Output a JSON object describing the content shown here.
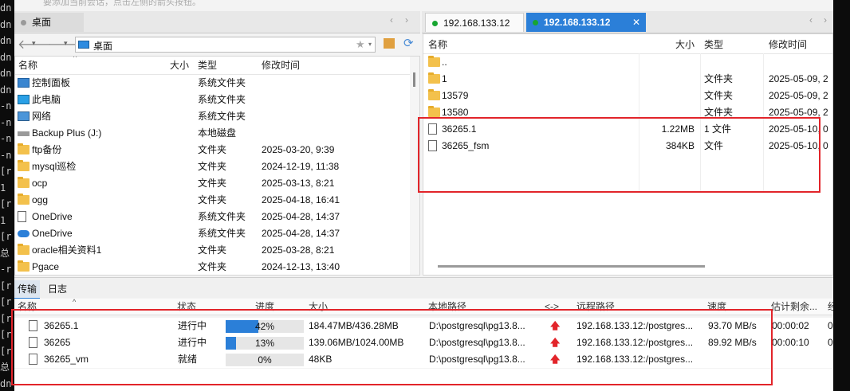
{
  "top_hint": "要添加当前会话，点击左侧的箭头按钮。",
  "terminal_lines": [
    "dn",
    "dn",
    "dn",
    "dn",
    "dn",
    "dn",
    "-n",
    "-n",
    "-n",
    "-n",
    "[r",
    "1",
    "[r",
    "1",
    "[r",
    "总",
    "-r",
    "[r",
    "[r",
    "[r",
    "[r",
    "[r",
    "总",
    "dn",
    "dn"
  ],
  "left_tab": {
    "label": "桌面"
  },
  "right_tabs": [
    {
      "label": "192.168.133.12",
      "active": false
    },
    {
      "label": "192.168.133.12",
      "active": true
    }
  ],
  "address": {
    "path": "桌面"
  },
  "left_pane": {
    "columns": [
      "名称",
      "大小",
      "类型",
      "修改时间"
    ],
    "rows": [
      {
        "name": "控制面板",
        "size": "",
        "type": "系统文件夹",
        "mtime": "",
        "icon": "control-panel-icon"
      },
      {
        "name": "此电脑",
        "size": "",
        "type": "系统文件夹",
        "mtime": "",
        "icon": "computer-icon"
      },
      {
        "name": "网络",
        "size": "",
        "type": "系统文件夹",
        "mtime": "",
        "icon": "network-icon"
      },
      {
        "name": "Backup Plus (J:)",
        "size": "",
        "type": "本地磁盘",
        "mtime": "",
        "icon": "drive-icon"
      },
      {
        "name": "ftp备份",
        "size": "",
        "type": "文件夹",
        "mtime": "2025-03-20, 9:39",
        "icon": "folder-icon"
      },
      {
        "name": "mysql巡检",
        "size": "",
        "type": "文件夹",
        "mtime": "2024-12-19, 11:38",
        "icon": "folder-icon"
      },
      {
        "name": "ocp",
        "size": "",
        "type": "文件夹",
        "mtime": "2025-03-13, 8:21",
        "icon": "folder-icon"
      },
      {
        "name": "ogg",
        "size": "",
        "type": "文件夹",
        "mtime": "2025-04-18, 16:41",
        "icon": "folder-icon"
      },
      {
        "name": "OneDrive",
        "size": "",
        "type": "系统文件夹",
        "mtime": "2025-04-28, 14:37",
        "icon": "file-icon"
      },
      {
        "name": "OneDrive",
        "size": "",
        "type": "系统文件夹",
        "mtime": "2025-04-28, 14:37",
        "icon": "cloud-icon"
      },
      {
        "name": "oracle相关资料1",
        "size": "",
        "type": "文件夹",
        "mtime": "2025-03-28, 8:21",
        "icon": "folder-icon"
      },
      {
        "name": "Pgace",
        "size": "",
        "type": "文件夹",
        "mtime": "2024-12-13, 13:40",
        "icon": "folder-icon"
      }
    ]
  },
  "right_pane": {
    "columns": [
      "名称",
      "大小",
      "类型",
      "修改时间"
    ],
    "rows": [
      {
        "name": "..",
        "size": "",
        "type": "",
        "mtime": "",
        "icon": "folder-icon"
      },
      {
        "name": "1",
        "size": "",
        "type": "文件夹",
        "mtime": "2025-05-09, 2",
        "icon": "folder-icon"
      },
      {
        "name": "13579",
        "size": "",
        "type": "文件夹",
        "mtime": "2025-05-09, 2",
        "icon": "folder-icon"
      },
      {
        "name": "13580",
        "size": "",
        "type": "文件夹",
        "mtime": "2025-05-09, 2",
        "icon": "folder-icon"
      },
      {
        "name": "36265.1",
        "size": "1.22MB",
        "type": "1 文件",
        "mtime": "2025-05-10, 0",
        "icon": "file-icon"
      },
      {
        "name": "36265_fsm",
        "size": "384KB",
        "type": "文件",
        "mtime": "2025-05-10, 0",
        "icon": "file-icon"
      }
    ]
  },
  "bottom_tabs": [
    "传输",
    "日志"
  ],
  "transfer": {
    "columns": [
      "名称",
      "状态",
      "进度",
      "大小",
      "本地路径",
      "<->",
      "远程路径",
      "速度",
      "估计剩余...",
      "经"
    ],
    "rows": [
      {
        "name": "36265.1",
        "status": "进行中",
        "progress_label": "42%",
        "progress": 0.42,
        "size": "184.47MB/436.28MB",
        "local": "D:\\postgresql\\pg13.8...",
        "dir": "🡅",
        "remote": "192.168.133.12:/postgres...",
        "speed": "93.70 MB/s",
        "eta": "00:00:02",
        "extra": "0"
      },
      {
        "name": "36265",
        "status": "进行中",
        "progress_label": "13%",
        "progress": 0.13,
        "size": "139.06MB/1024.00MB",
        "local": "D:\\postgresql\\pg13.8...",
        "dir": "🡅",
        "remote": "192.168.133.12:/postgres...",
        "speed": "89.92 MB/s",
        "eta": "00:00:10",
        "extra": "0"
      },
      {
        "name": "36265_vm",
        "status": "就绪",
        "progress_label": "0%",
        "progress": 0,
        "size": "48KB",
        "local": "D:\\postgresql\\pg13.8...",
        "dir": "🡅",
        "remote": "192.168.133.12:/postgres...",
        "speed": "",
        "eta": "",
        "extra": ""
      }
    ]
  },
  "colors": {
    "accent": "#2b7fd8",
    "highlight": "#e2242a",
    "active_tab_bg": "#2b7fd8",
    "dot_green": "#17a531"
  }
}
